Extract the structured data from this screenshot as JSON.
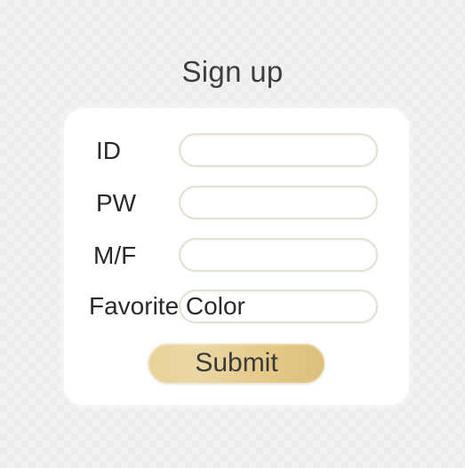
{
  "page": {
    "title": "Sign up"
  },
  "form": {
    "fields": [
      {
        "label": "ID",
        "value": "",
        "placeholder": ""
      },
      {
        "label": "PW",
        "value": "",
        "placeholder": ""
      },
      {
        "label": "M/F",
        "value": "",
        "placeholder": ""
      },
      {
        "label": "Favorite Color",
        "value": "",
        "placeholder": ""
      }
    ],
    "submit_label": "Submit"
  },
  "colors": {
    "background": "#f1f1f1",
    "card": "#ffffff",
    "field_border": "#e6e0d2",
    "submit_gold": "#e6cb8c",
    "text": "#2a2a2a"
  }
}
